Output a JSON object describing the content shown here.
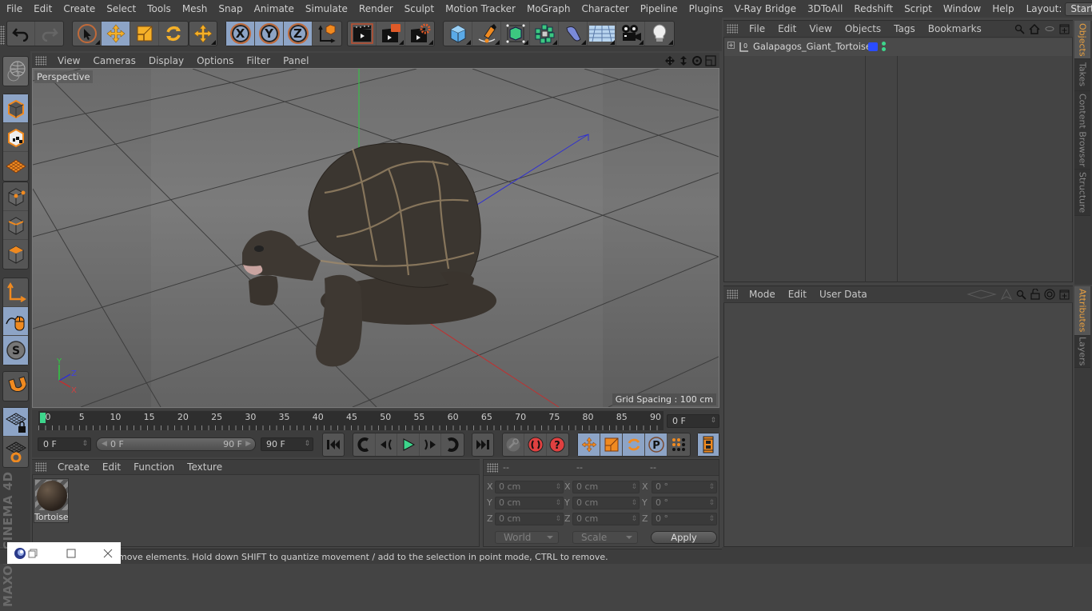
{
  "menubar": {
    "items": [
      "File",
      "Edit",
      "Create",
      "Select",
      "Tools",
      "Mesh",
      "Snap",
      "Animate",
      "Simulate",
      "Render",
      "Sculpt",
      "Motion Tracker",
      "MoGraph",
      "Character",
      "Pipeline",
      "Plugins",
      "V-Ray Bridge",
      "3DToAll",
      "Redshift",
      "Script",
      "Window",
      "Help"
    ],
    "layout_label": "Layout:",
    "layout_value": "Startup"
  },
  "toolbar": {
    "groups": [
      [
        "undo-icon",
        "redo-icon"
      ],
      [
        "live-selection-icon",
        "move-icon",
        "scale-icon",
        "rotate-icon"
      ],
      [
        "transform-icon"
      ],
      [
        "x-axis-lock-icon",
        "y-axis-lock-icon",
        "z-axis-lock-icon",
        "coordinate-system-icon"
      ],
      [
        "render-view-icon",
        "render-to-picture-viewer-icon",
        "render-settings-icon"
      ],
      [
        "cube-icon",
        "pen-icon",
        "subdivision-icon",
        "cloner-icon",
        "deformer-icon",
        "floor-icon",
        "camera-icon",
        "light-icon"
      ]
    ],
    "axis_labels": [
      "X",
      "Y",
      "Z"
    ]
  },
  "left_toolbar": {
    "items": [
      "make-editable-icon",
      "model-mode-icon",
      "texture-mode-icon",
      "workplane-icon",
      "points-mode-icon",
      "edges-mode-icon",
      "polygons-mode-icon",
      "axis-mode-icon",
      "tweak-mode-icon",
      "snap-icon",
      "magnet-icon",
      "locked-workplane-icon",
      "planar-workplane-icon"
    ]
  },
  "viewport": {
    "menu": [
      "View",
      "Cameras",
      "Display",
      "Options",
      "Filter",
      "Panel"
    ],
    "camera_label": "Perspective",
    "grid_spacing": "Grid Spacing : 100 cm",
    "axis_gizmo": {
      "y": "Y",
      "z": "Z",
      "x": "X"
    },
    "nav_icons": [
      "pan-icon",
      "dolly-icon",
      "orbit-icon",
      "maximize-view-icon"
    ]
  },
  "timeline": {
    "ticks": [
      0,
      5,
      10,
      15,
      20,
      25,
      30,
      35,
      40,
      45,
      50,
      55,
      60,
      65,
      70,
      75,
      80,
      85,
      90
    ],
    "current_frame": 0,
    "max_frame": 90,
    "current_frame_field": "0 F",
    "start_field": "0 F",
    "range_start": "0 F",
    "range_end": "90 F",
    "end_field": "90 F"
  },
  "playback": {
    "buttons": [
      "go-to-start-icon",
      "previous-key-icon",
      "previous-frame-icon",
      "play-icon",
      "next-frame-icon",
      "next-key-icon",
      "go-to-end-icon"
    ],
    "key_buttons": [
      "record-key-icon",
      "autokey-icon",
      "keyframe-selection-icon"
    ],
    "key_modes": [
      "position-key-icon",
      "scale-key-icon",
      "rotation-key-icon",
      "parameter-key-icon",
      "point-level-animation-icon"
    ],
    "timeline_button": "timeline-icon"
  },
  "materials": {
    "menu": [
      "Create",
      "Edit",
      "Function",
      "Texture"
    ],
    "items": [
      {
        "name": "Tortoise"
      }
    ]
  },
  "coordinates": {
    "headers": [
      "--",
      "--",
      "--"
    ],
    "rows": [
      {
        "axis": "X",
        "pos": "0 cm",
        "size": "0 cm",
        "rot": "0 °"
      },
      {
        "axis": "Y",
        "pos": "0 cm",
        "size": "0 cm",
        "rot": "0 °"
      },
      {
        "axis": "Z",
        "pos": "0 cm",
        "size": "0 cm",
        "rot": "0 °"
      }
    ],
    "space_dropdown": "World",
    "mode_dropdown": "Scale",
    "apply_label": "Apply"
  },
  "objects_panel": {
    "menu": [
      "File",
      "Edit",
      "View",
      "Objects",
      "Tags",
      "Bookmarks"
    ],
    "items": [
      {
        "name": "Galapagos_Giant_Tortoise",
        "layer_color": "#2a4cff"
      }
    ]
  },
  "attributes_panel": {
    "menu": [
      "Mode",
      "Edit",
      "User Data"
    ]
  },
  "right_tabs_top": [
    {
      "label": "Objects",
      "active": true
    },
    {
      "label": "Takes",
      "active": false
    },
    {
      "label": "Content Browser",
      "active": false
    },
    {
      "label": "Structure",
      "active": false
    }
  ],
  "right_tabs_bottom": [
    {
      "label": "Attributes",
      "active": true
    },
    {
      "label": "Layers",
      "active": false
    }
  ],
  "status_text": "move elements. Hold down SHIFT to quantize movement / add to the selection in point mode, CTRL to remove.",
  "branding": "MAXON CINEMA 4D",
  "colors": {
    "accent_orange": "#f0a030",
    "selected_blue": "#8da4c6",
    "playhead_green": "#3dd68c"
  }
}
